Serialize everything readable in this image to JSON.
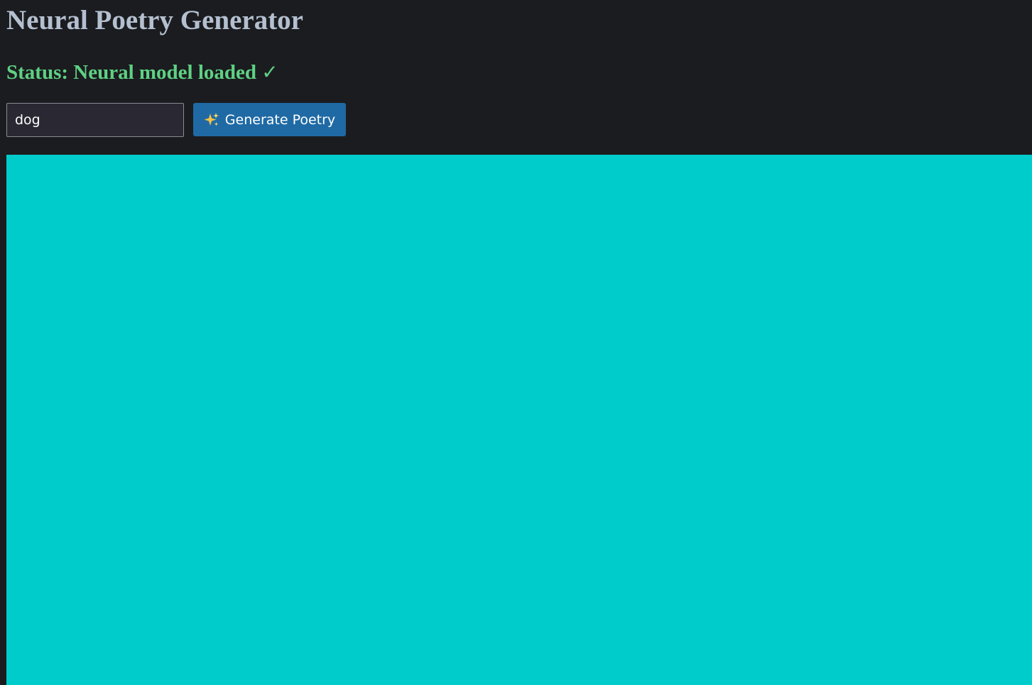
{
  "header": {
    "title": "Neural Poetry Generator"
  },
  "status": {
    "label": "Status: Neural model loaded",
    "check_glyph": "✓",
    "color": "#5ed184"
  },
  "prompt": {
    "value": "dog",
    "placeholder": ""
  },
  "generate_button": {
    "label": "Generate Poetry",
    "icon": "sparkles-icon",
    "color": "#1f6aa5"
  },
  "output": {
    "background_color": "#00cccc"
  },
  "theme": {
    "page_background": "#1b1c1f",
    "title_color": "#b4c0d0"
  }
}
